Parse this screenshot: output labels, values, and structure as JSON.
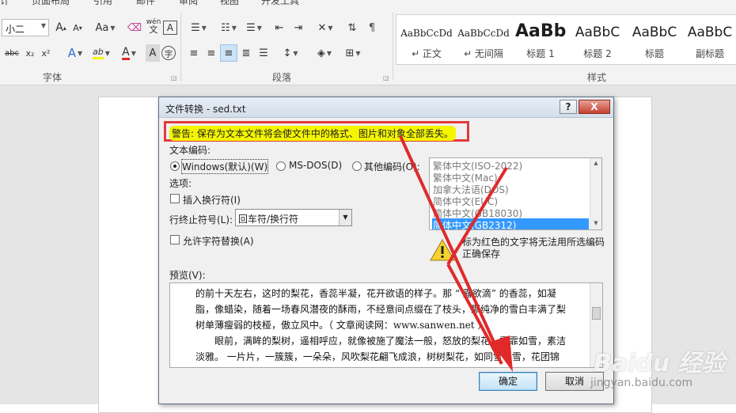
{
  "ribbon": {
    "tabs": [
      "计",
      "页面布局",
      "引用",
      "邮件",
      "审阅",
      "视图",
      "开发工具"
    ],
    "font_size": "小二",
    "font_group_label": "字体",
    "paragraph_group_label": "段落",
    "styles_group_label": "样式",
    "buttons": {
      "grow_font": "A",
      "shrink_font": "A",
      "change_case": "Aa",
      "phonetic": "wén",
      "char_border": "A",
      "strikethrough": "abc",
      "subscript": "x₂",
      "superscript": "x²",
      "text_effects": "A",
      "highlight": "ab",
      "font_color": "A",
      "char_shading": "A",
      "enclose": "字"
    },
    "styles": [
      {
        "sample": "AaBbCcDd",
        "name": "↵ 正文"
      },
      {
        "sample": "AaBbCcDd",
        "name": "↵ 无间隔"
      },
      {
        "sample": "AaBb",
        "name": "标题 1"
      },
      {
        "sample": "AaBbC",
        "name": "标题 2"
      },
      {
        "sample": "AaBbC",
        "name": "标题"
      },
      {
        "sample": "AaBbC",
        "name": "副标题"
      }
    ]
  },
  "dialog": {
    "title": "文件转换 - sed.txt",
    "help": "?",
    "close": "X",
    "warning": "警告: 保存为文本文件将会使文件中的格式、图片和对象全部丢失。",
    "encoding_label": "文本编码:",
    "radio_windows": "Windows(默认)(W)",
    "radio_msdos": "MS-DOS(D)",
    "radio_other": "其他编码(O):",
    "options_label": "选项:",
    "insert_linebreaks": "插入换行符(I)",
    "eol_label": "行终止符号(L):",
    "eol_value": "回车符/换行符",
    "allow_substitution": "允许字符替换(A)",
    "encodings": [
      "繁体中文(ISO-2022)",
      "繁体中文(Mac)",
      "加拿大法语(DOS)",
      "简体中文(EUC)",
      "简体中文(GB18030)",
      "简体中文(GB2312)"
    ],
    "selected_encoding": "简体中文(GB2312)",
    "note": "标为红色的文字将无法用所选编码正确保存",
    "preview_label": "预览(V):",
    "preview_lines": [
      "的前十天左右，这时的梨花，香蕊半凝，花开欲语的样子。那 “ 露欲滴” 的香蕊，如凝",
      "脂，像蜡染，随着一场春风潜夜的酥雨，不经意间点缀在了枝头，那纯净的雪白丰满了梨",
      "树单薄瘦弱的枝桠，傲立风中。（  文章阅读网：www.sanwen.net  ）",
      "　　眼前，满眸的梨树，遥相呼应，就像被施了魔法一般，怒放的梨花，霏霏如雪，素洁",
      "淡雅。 一片片，一簇簇，一朵朵，风吹梨花翩飞成浪，树树梨花，如同雪飞雪，花团锦"
    ],
    "ok": "确定",
    "cancel": "取消"
  },
  "watermark": {
    "brand": "Baidu 经验",
    "url": "jingyan.baidu.com"
  },
  "colors": {
    "annotation_red": "#e02a2a",
    "highlight_yellow": "#f5f500",
    "selection_blue": "#3399ff"
  }
}
